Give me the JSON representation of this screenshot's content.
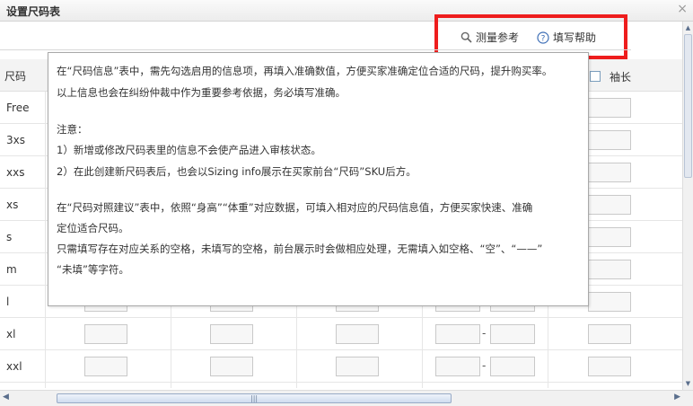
{
  "dialog": {
    "title": "设置尺码表",
    "close_icon": "×"
  },
  "toolbar": {
    "measure_label": "测量参考",
    "help_label": "填写帮助",
    "accent": "#3e6fb6",
    "highlight_color": "#ee1d1d"
  },
  "table": {
    "size_header": "尺码",
    "sleeve_header": "袖长",
    "sizes": [
      "Free",
      "3xs",
      "xxs",
      "xs",
      "s",
      "m",
      "l",
      "xl",
      "xxl"
    ],
    "range_separator": "-"
  },
  "tooltip": {
    "lines": [
      "在“尺码信息”表中，需先勾选启用的信息项，再填入准确数值，方便买家准确定位合适的尺码，提升购买率。",
      "以上信息也会在纠纷仲裁中作为重要参考依据，务必填写准确。",
      "注意：",
      "1）新增或修改尺码表里的信息不会使产品进入审核状态。",
      "2）在此创建新尺码表后，也会以Sizing info展示在买家前台“尺码”SKU后方。",
      "在“尺码对照建议”表中，依照“身高”“体重”对应数据，可填入相对应的尺码信息值，方便买家快速、准确",
      "定位适合尺码。",
      "只需填写存在对应关系的空格，未填写的空格，前台展示时会做相应处理，无需填入如空格、“空”、“——”",
      "“未填”等字符。"
    ]
  }
}
